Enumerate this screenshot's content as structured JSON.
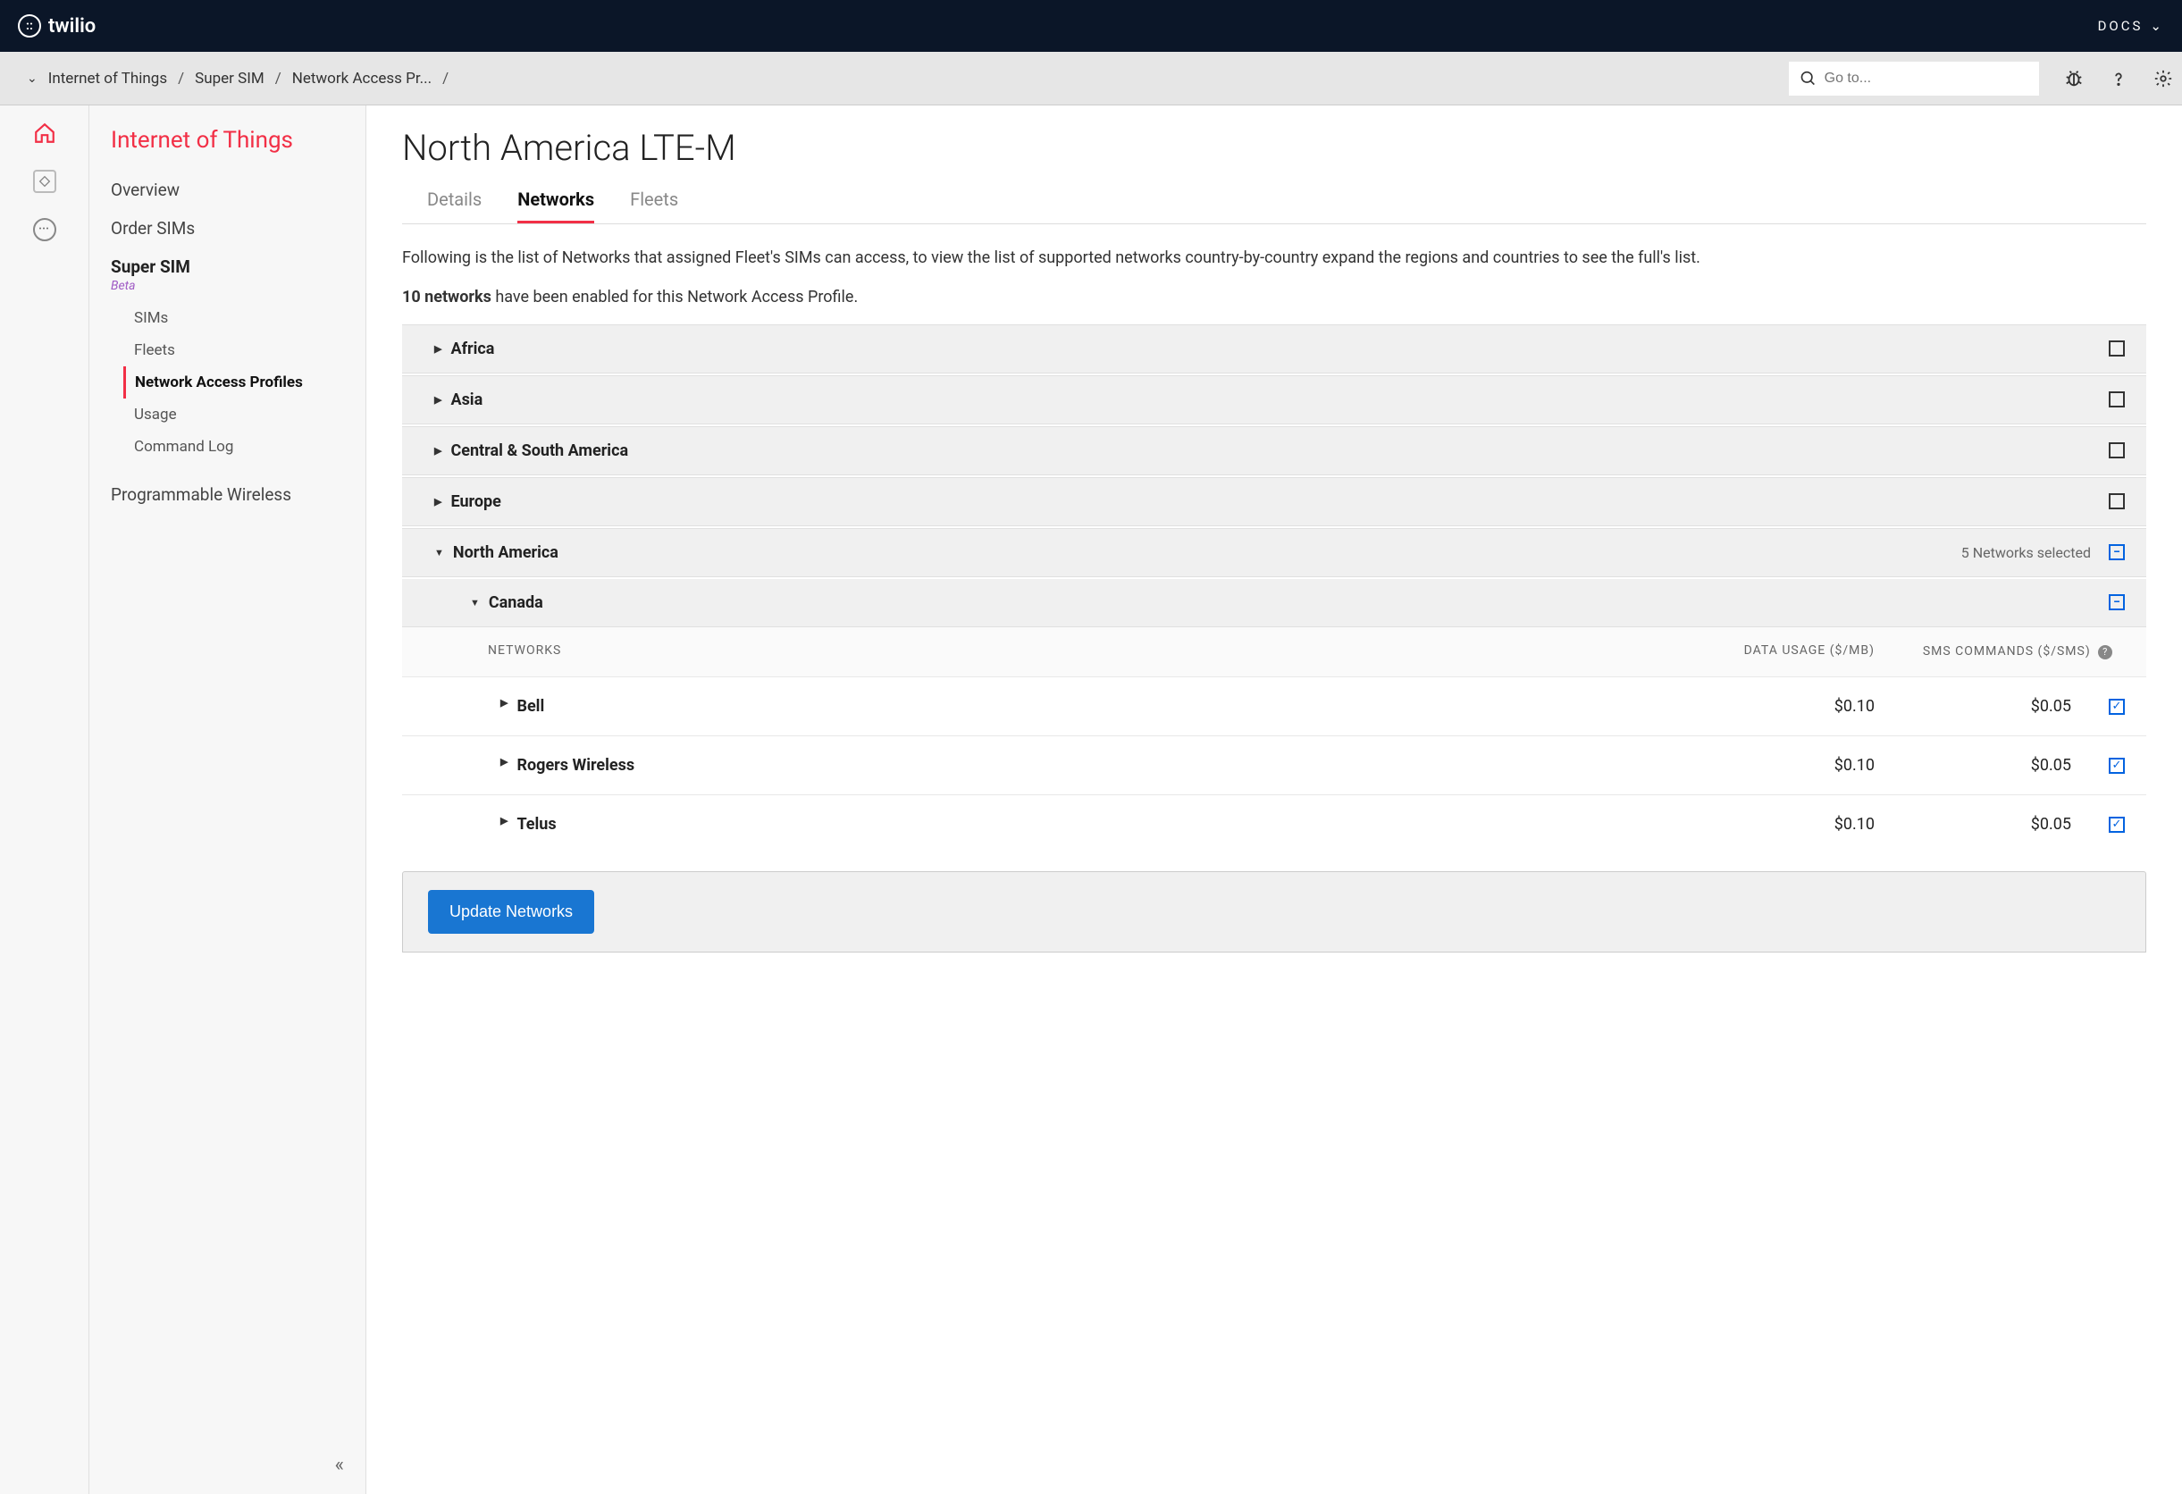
{
  "topbar": {
    "brand": "twilio",
    "docs": "DOCS"
  },
  "breadcrumb": {
    "root": "Internet of Things",
    "mid": "Super SIM",
    "leaf": "Network Access Pr..."
  },
  "search": {
    "placeholder": "Go to..."
  },
  "sidebar": {
    "title": "Internet of Things",
    "overview": "Overview",
    "order": "Order SIMs",
    "super": "Super SIM",
    "badge": "Beta",
    "sub": {
      "sims": "SIMs",
      "fleets": "Fleets",
      "nap": "Network Access Profiles",
      "usage": "Usage",
      "cmdlog": "Command Log"
    },
    "prog": "Programmable Wireless"
  },
  "page": {
    "title": "North America LTE-M",
    "tabs": {
      "details": "Details",
      "networks": "Networks",
      "fleets": "Fleets"
    },
    "desc": "Following is the list of Networks that assigned Fleet's SIMs can access, to view the list of supported networks country-by-country expand the regions and countries to see the full's list.",
    "count_strong": "10 networks",
    "count_rest": " have been enabled for this Network Access Profile."
  },
  "regions": {
    "africa": "Africa",
    "asia": "Asia",
    "csamerica": "Central & South America",
    "europe": "Europe",
    "namerica": "North America",
    "na_selected": "5 Networks selected"
  },
  "country": {
    "canada": "Canada"
  },
  "table": {
    "th_net": "NETWORKS",
    "th_data": "DATA USAGE ($/MB)",
    "th_sms": "SMS COMMANDS ($/SMS)"
  },
  "rows": {
    "bell": {
      "name": "Bell",
      "data": "$0.10",
      "sms": "$0.05"
    },
    "rogers": {
      "name": "Rogers Wireless",
      "data": "$0.10",
      "sms": "$0.05"
    },
    "telus": {
      "name": "Telus",
      "data": "$0.10",
      "sms": "$0.05"
    }
  },
  "footer": {
    "update": "Update Networks"
  }
}
